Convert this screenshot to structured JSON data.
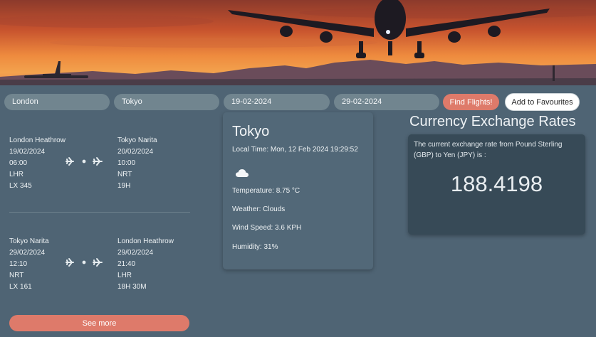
{
  "search": {
    "from": "London",
    "to": "Tokyo",
    "depart_date": "19-02-2024",
    "return_date": "29-02-2024",
    "find_label": "Find Flights!",
    "favourite_label": "Add to Favourites"
  },
  "flights": {
    "outbound": {
      "dep_airport": "London Heathrow",
      "dep_date": "19/02/2024",
      "dep_time": "06:00",
      "dep_code": "LHR",
      "flight_no": "LX 345",
      "arr_airport": "Tokyo Narita",
      "arr_date": "20/02/2024",
      "arr_time": "10:00",
      "arr_code": "NRT",
      "duration": "19H"
    },
    "inbound": {
      "dep_airport": "Tokyo Narita",
      "dep_date": "29/02/2024",
      "dep_time": "12:10",
      "dep_code": "NRT",
      "flight_no": "LX 161",
      "arr_airport": "London Heathrow",
      "arr_date": "29/02/2024",
      "arr_time": "21:40",
      "arr_code": "LHR",
      "duration": "18H 30M"
    },
    "see_more_label": "See more"
  },
  "weather": {
    "city": "Tokyo",
    "local_time": "Local Time: Mon, 12 Feb 2024 19:29:52",
    "icon": "cloud-icon",
    "temperature": "Temperature: 8.75 °C",
    "condition": "Weather: Clouds",
    "wind": "Wind Speed: 3.6 KPH",
    "humidity": "Humidity: 31%"
  },
  "currency": {
    "title": "Currency Exchange Rates",
    "description": "The current exchange rate from Pound Sterling (GBP) to Yen (JPY) is :",
    "rate": "188.4198"
  },
  "colors": {
    "background": "#4f6474",
    "field": "#71858f",
    "accent": "#de7a6a",
    "card": "#374a57"
  }
}
